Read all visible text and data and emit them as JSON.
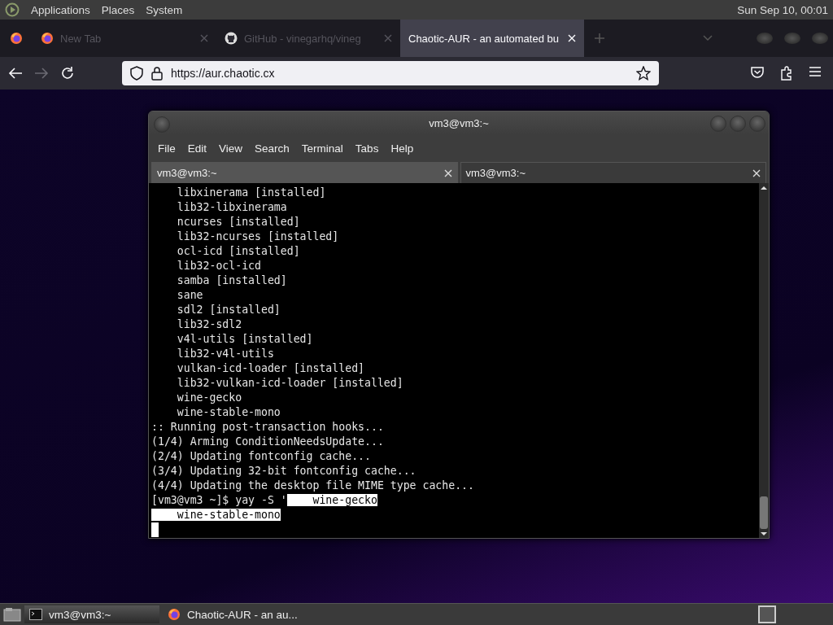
{
  "top_panel": {
    "menus": [
      "Applications",
      "Places",
      "System"
    ],
    "clock": "Sun Sep 10, 00:01"
  },
  "browser": {
    "tabs": [
      {
        "title": "New Tab",
        "selected": false,
        "kind": "firefox"
      },
      {
        "title": "GitHub - vinegarhq/vineg",
        "selected": false,
        "kind": "github"
      },
      {
        "title": "Chaotic-AUR - an automated bu",
        "selected": true,
        "kind": "plain"
      }
    ],
    "nav": {
      "back_disabled": false,
      "forward_disabled": true
    },
    "url": "https://aur.chaotic.cx"
  },
  "terminal": {
    "title": "vm3@vm3:~",
    "menu": [
      "File",
      "Edit",
      "View",
      "Search",
      "Terminal",
      "Tabs",
      "Help"
    ],
    "tabs": [
      {
        "title": "vm3@vm3:~",
        "selected": true
      },
      {
        "title": "vm3@vm3:~",
        "selected": false
      }
    ],
    "lines": [
      {
        "text": "    libxinerama [installed]"
      },
      {
        "text": "    lib32-libxinerama"
      },
      {
        "text": "    ncurses [installed]"
      },
      {
        "text": "    lib32-ncurses [installed]"
      },
      {
        "text": "    ocl-icd [installed]"
      },
      {
        "text": "    lib32-ocl-icd"
      },
      {
        "text": "    samba [installed]"
      },
      {
        "text": "    sane"
      },
      {
        "text": "    sdl2 [installed]"
      },
      {
        "text": "    lib32-sdl2"
      },
      {
        "text": "    v4l-utils [installed]"
      },
      {
        "text": "    lib32-v4l-utils"
      },
      {
        "text": "    vulkan-icd-loader [installed]"
      },
      {
        "text": "    lib32-vulkan-icd-loader [installed]"
      },
      {
        "text": "    wine-gecko"
      },
      {
        "text": "    wine-stable-mono"
      },
      {
        "text": ":: Running post-transaction hooks..."
      },
      {
        "text": "(1/4) Arming ConditionNeedsUpdate..."
      },
      {
        "text": "(2/4) Updating fontconfig cache..."
      },
      {
        "text": "(3/4) Updating 32-bit fontconfig cache..."
      },
      {
        "text": "(4/4) Updating the desktop file MIME type cache..."
      },
      {
        "text": "[vm3@vm3 ~]$ yay -S '",
        "selected_text": "    wine-gecko"
      },
      {
        "selected_text": "    wine-stable-mono"
      }
    ]
  },
  "taskbar": {
    "items": [
      {
        "label": "vm3@vm3:~",
        "kind": "terminal",
        "selected": true
      },
      {
        "label": "Chaotic-AUR - an au...",
        "kind": "firefox",
        "selected": false
      }
    ]
  }
}
